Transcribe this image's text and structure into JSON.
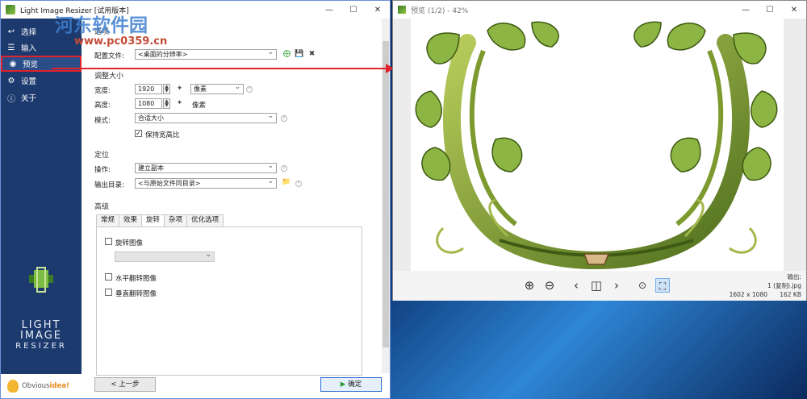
{
  "main_window": {
    "title": "Light Image Resizer  [试用版本]",
    "controls": {
      "minimize": "—",
      "maximize": "☐",
      "close": "✕"
    }
  },
  "watermark": {
    "text": "河东软件园",
    "url": "www.pc0359.cn"
  },
  "sidebar": {
    "items": [
      {
        "label": "选择",
        "icon": "back-icon"
      },
      {
        "label": "输入",
        "icon": "list-icon"
      },
      {
        "label": "预览",
        "icon": "eye-icon"
      },
      {
        "label": "设置",
        "icon": "gear-icon"
      },
      {
        "label": "关于",
        "icon": "info-icon"
      }
    ],
    "logo_line1": "LIGHT",
    "logo_line2": "IMAGE",
    "logo_line3": "RESIZER",
    "vendor_prefix": "Obvious",
    "vendor_suffix": "idea!"
  },
  "content": {
    "section_top": "选项",
    "profile_label": "配置文件:",
    "profile_value": "<桌面的分辨率>",
    "resize_header": "调整大小",
    "width_label": "宽度:",
    "width_value": "1920",
    "width_unit": "像素",
    "height_label": "高度:",
    "height_value": "1080",
    "height_unit": "像素",
    "mode_label": "模式:",
    "mode_value": "合适大小",
    "keep_ratio_label": "保持宽高比",
    "keep_ratio_checked": true,
    "position_header": "定位",
    "action_label": "操作:",
    "action_value": "建立副本",
    "output_label": "输出目录:",
    "output_value": "<与原始文件同目录>",
    "advanced_header": "高级",
    "tabs": [
      "常规",
      "效果",
      "旋转",
      "杂项",
      "优化选项"
    ],
    "active_tab": "旋转",
    "rotate_label": "旋转图像",
    "flip_h_label": "水平翻转图像",
    "flip_v_label": "垂直翻转图像",
    "back_button": "< 上一步",
    "ok_button": "确定"
  },
  "preview_window": {
    "title": "预览 (1/2) - 42%",
    "output_label": "输出:",
    "output_file": "1 (复制).jpg",
    "dimensions": "1602 x 1080",
    "file_size": "162 KB",
    "toolbar_icons": [
      "zoom-in-icon",
      "zoom-out-icon",
      "prev-icon",
      "compare-icon",
      "next-icon",
      "actual-size-icon",
      "fit-icon"
    ]
  },
  "colors": {
    "sidebar_bg": "#1d3a6e",
    "highlight": "#e0222a",
    "accent": "#2a6bd3"
  }
}
